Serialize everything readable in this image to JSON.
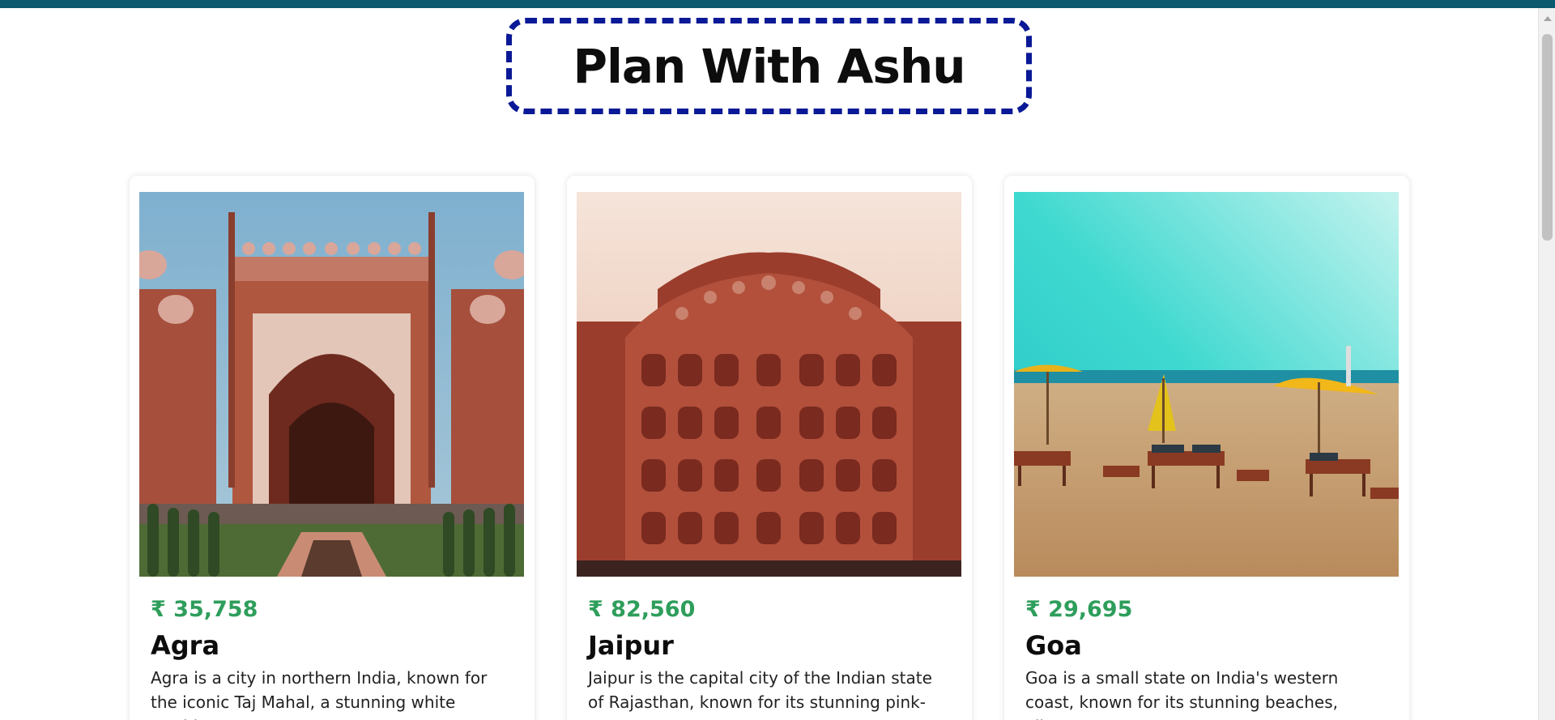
{
  "header": {
    "title": "Plan With Ashu",
    "accent_color": "#0b5a6e",
    "border_color": "#0a1996"
  },
  "cards": [
    {
      "price": "₹ 35,758",
      "city": "Agra",
      "description": "Agra is a city in northern India, known for the iconic Taj Mahal, a stunning white marble",
      "image": "taj-mahal-gate-image"
    },
    {
      "price": "₹ 82,560",
      "city": "Jaipur",
      "description": "Jaipur is the capital city of the Indian state of Rajasthan, known for its stunning pink-",
      "image": "hawa-mahal-image"
    },
    {
      "price": "₹ 29,695",
      "city": "Goa",
      "description": "Goa is a small state on India's western coast, known for its stunning beaches, vibrant",
      "image": "goa-beach-image"
    }
  ],
  "colors": {
    "price": "#2e9e5b"
  }
}
